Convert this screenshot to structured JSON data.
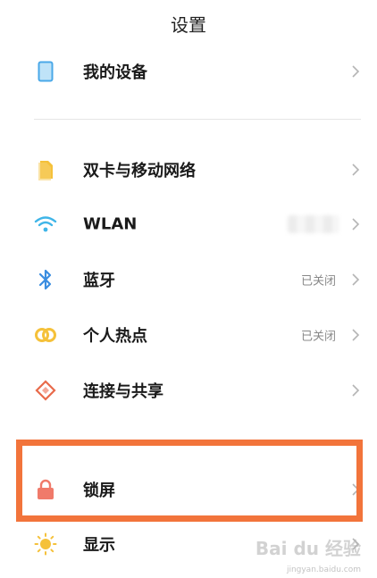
{
  "header": {
    "title": "设置"
  },
  "rows": [
    {
      "label": "我的设备",
      "icon": "device-icon"
    },
    {
      "label": "双卡与移动网络",
      "icon": "sim-icon"
    },
    {
      "label": "WLAN",
      "icon": "wifi-icon"
    },
    {
      "label": "蓝牙",
      "status": "已关闭",
      "icon": "bluetooth-icon"
    },
    {
      "label": "个人热点",
      "status": "已关闭",
      "icon": "hotspot-icon"
    },
    {
      "label": "连接与共享",
      "icon": "connection-share-icon"
    },
    {
      "label": "锁屏",
      "icon": "lock-icon"
    },
    {
      "label": "显示",
      "icon": "brightness-icon"
    }
  ],
  "colors": {
    "highlight": "#f2743b",
    "device": "#4aa8e8",
    "sim": "#f5c13a",
    "wifi": "#3fb5e8",
    "bluetooth": "#3a8de0",
    "hotspot": "#f5c13a",
    "share": "#e86a4a",
    "lock": "#f07a6a",
    "brightness": "#f5c13a"
  },
  "watermark": {
    "text": "Bai du 经验",
    "sub": "jingyan.baidu.com"
  }
}
